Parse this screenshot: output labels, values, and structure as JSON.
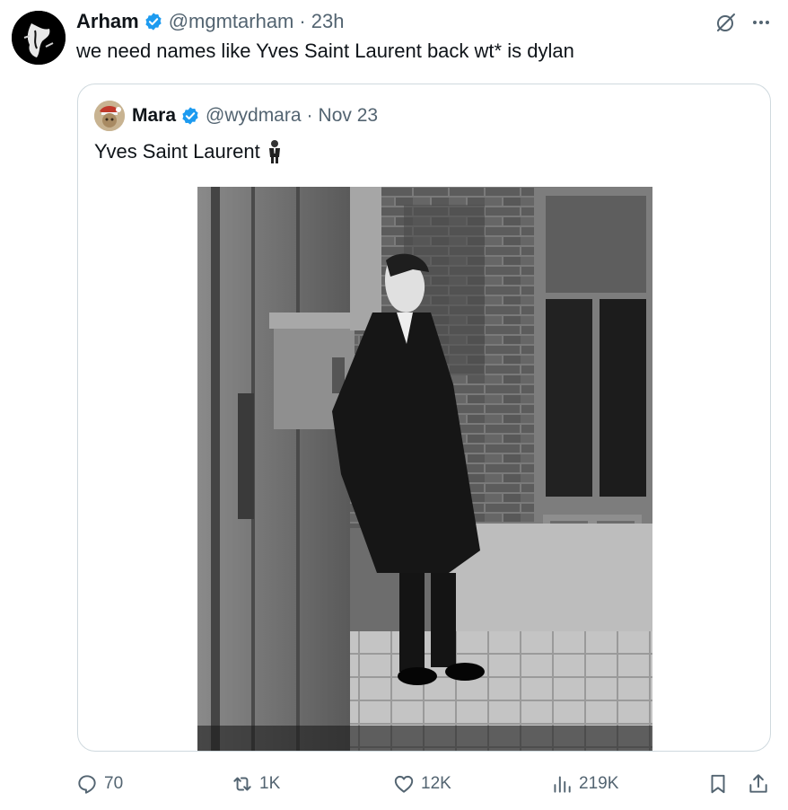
{
  "tweet": {
    "author_name": "Arham",
    "author_handle": "@mgmtarham",
    "separator": "·",
    "time": "23h",
    "text": "we need names like Yves Saint Laurent back wt* is dylan"
  },
  "quote": {
    "author_name": "Mara",
    "author_handle": "@wydmara",
    "separator": "·",
    "date": "Nov 23",
    "text": "Yves Saint Laurent"
  },
  "actions": {
    "replies": "70",
    "reposts": "1K",
    "likes": "12K",
    "views": "219K"
  },
  "colors": {
    "verified": "#1d9bf0",
    "secondary_text": "#536471",
    "border": "#cfd9de"
  },
  "icons": [
    "verified-icon",
    "grok-icon",
    "more-icon",
    "reply-icon",
    "repost-icon",
    "like-icon",
    "views-icon",
    "bookmark-icon",
    "share-icon",
    "man-in-suit-emoji-icon"
  ]
}
